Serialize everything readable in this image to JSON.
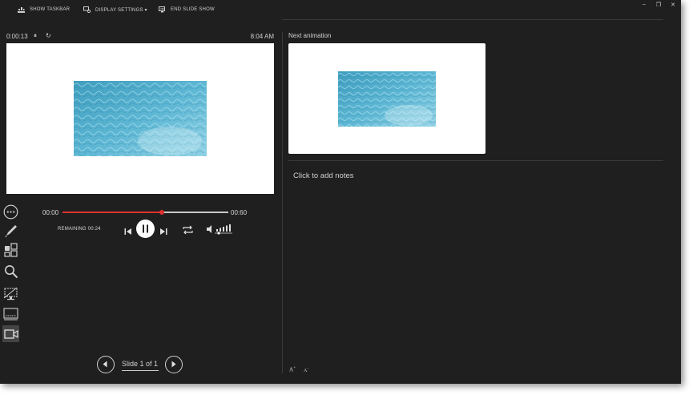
{
  "toolbar": {
    "show_taskbar": "SHOW TASKBAR",
    "display_settings": "DISPLAY SETTINGS ▾",
    "end_slide_show": "END SLIDE SHOW",
    "minimize": "‒",
    "restore": "❐",
    "close": "✕"
  },
  "presenter": {
    "elapsed": "0:00:13",
    "pause_timer": "⏸",
    "reset_timer": "↻",
    "clock": "8:04 AM"
  },
  "media": {
    "time_start": "00:00",
    "time_end": "00:60",
    "remaining": "REMAINING 00:24",
    "progress": 0.6,
    "volume_level": 0.8
  },
  "tools": [
    "more-options",
    "pen",
    "see-all-slides",
    "zoom",
    "black-screen",
    "subtitles",
    "camera"
  ],
  "navigation": {
    "slide_count": "Slide 1 of 1"
  },
  "next": {
    "label": "Next animation"
  },
  "notes": {
    "placeholder": "Click to add notes",
    "increase_font": "A",
    "decrease_font": "A"
  },
  "colors": {
    "background": "#1f1f1f",
    "progress": "#e03030",
    "water_light": "#9fd6e8",
    "water_dark": "#3f9dbe"
  }
}
